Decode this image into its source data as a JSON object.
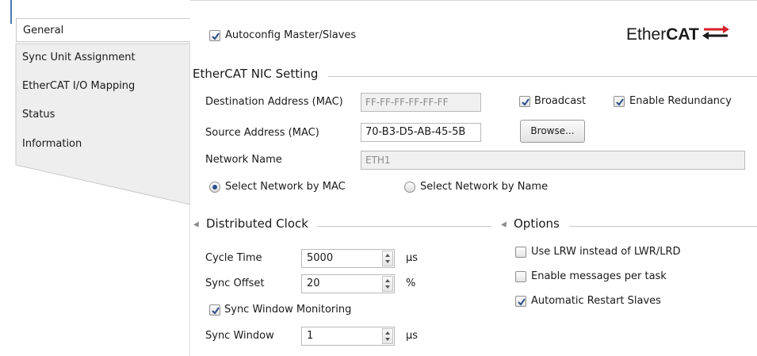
{
  "tabs": [
    {
      "label": "General",
      "active": true
    },
    {
      "label": "Sync Unit Assignment",
      "active": false
    },
    {
      "label": "EtherCAT I/O Mapping",
      "active": false
    },
    {
      "label": "Status",
      "active": false
    },
    {
      "label": "Information",
      "active": false
    }
  ],
  "logo": {
    "text_normal": "Ether",
    "text_bold": "CAT",
    "accent": "#d42027"
  },
  "autoconfig": {
    "label": "Autoconfig Master/Slaves",
    "checked": true
  },
  "nic": {
    "title": "EtherCAT NIC Setting",
    "dest_label": "Destination Address (MAC)",
    "dest_value": "FF-FF-FF-FF-FF-FF",
    "broadcast_label": "Broadcast",
    "broadcast_checked": true,
    "redundancy_label": "Enable Redundancy",
    "redundancy_checked": true,
    "source_label": "Source Address (MAC)",
    "source_value": "70-B3-D5-AB-45-5B",
    "browse_label": "Browse...",
    "network_name_label": "Network Name",
    "network_name_value": "ETH1",
    "by_mac_label": "Select Network by MAC",
    "by_mac_selected": true,
    "by_name_label": "Select Network by Name",
    "by_name_selected": false
  },
  "clock": {
    "title": "Distributed Clock",
    "cycle_label": "Cycle Time",
    "cycle_value": "5000",
    "cycle_unit": "µs",
    "offset_label": "Sync Offset",
    "offset_value": "20",
    "offset_unit": "%",
    "monitor_label": "Sync Window Monitoring",
    "monitor_checked": true,
    "window_label": "Sync Window",
    "window_value": "1",
    "window_unit": "µs"
  },
  "options": {
    "title": "Options",
    "lrw_label": "Use LRW instead of LWR/LRD",
    "lrw_checked": false,
    "msg_label": "Enable messages per task",
    "msg_checked": false,
    "restart_label": "Automatic Restart Slaves",
    "restart_checked": true
  }
}
